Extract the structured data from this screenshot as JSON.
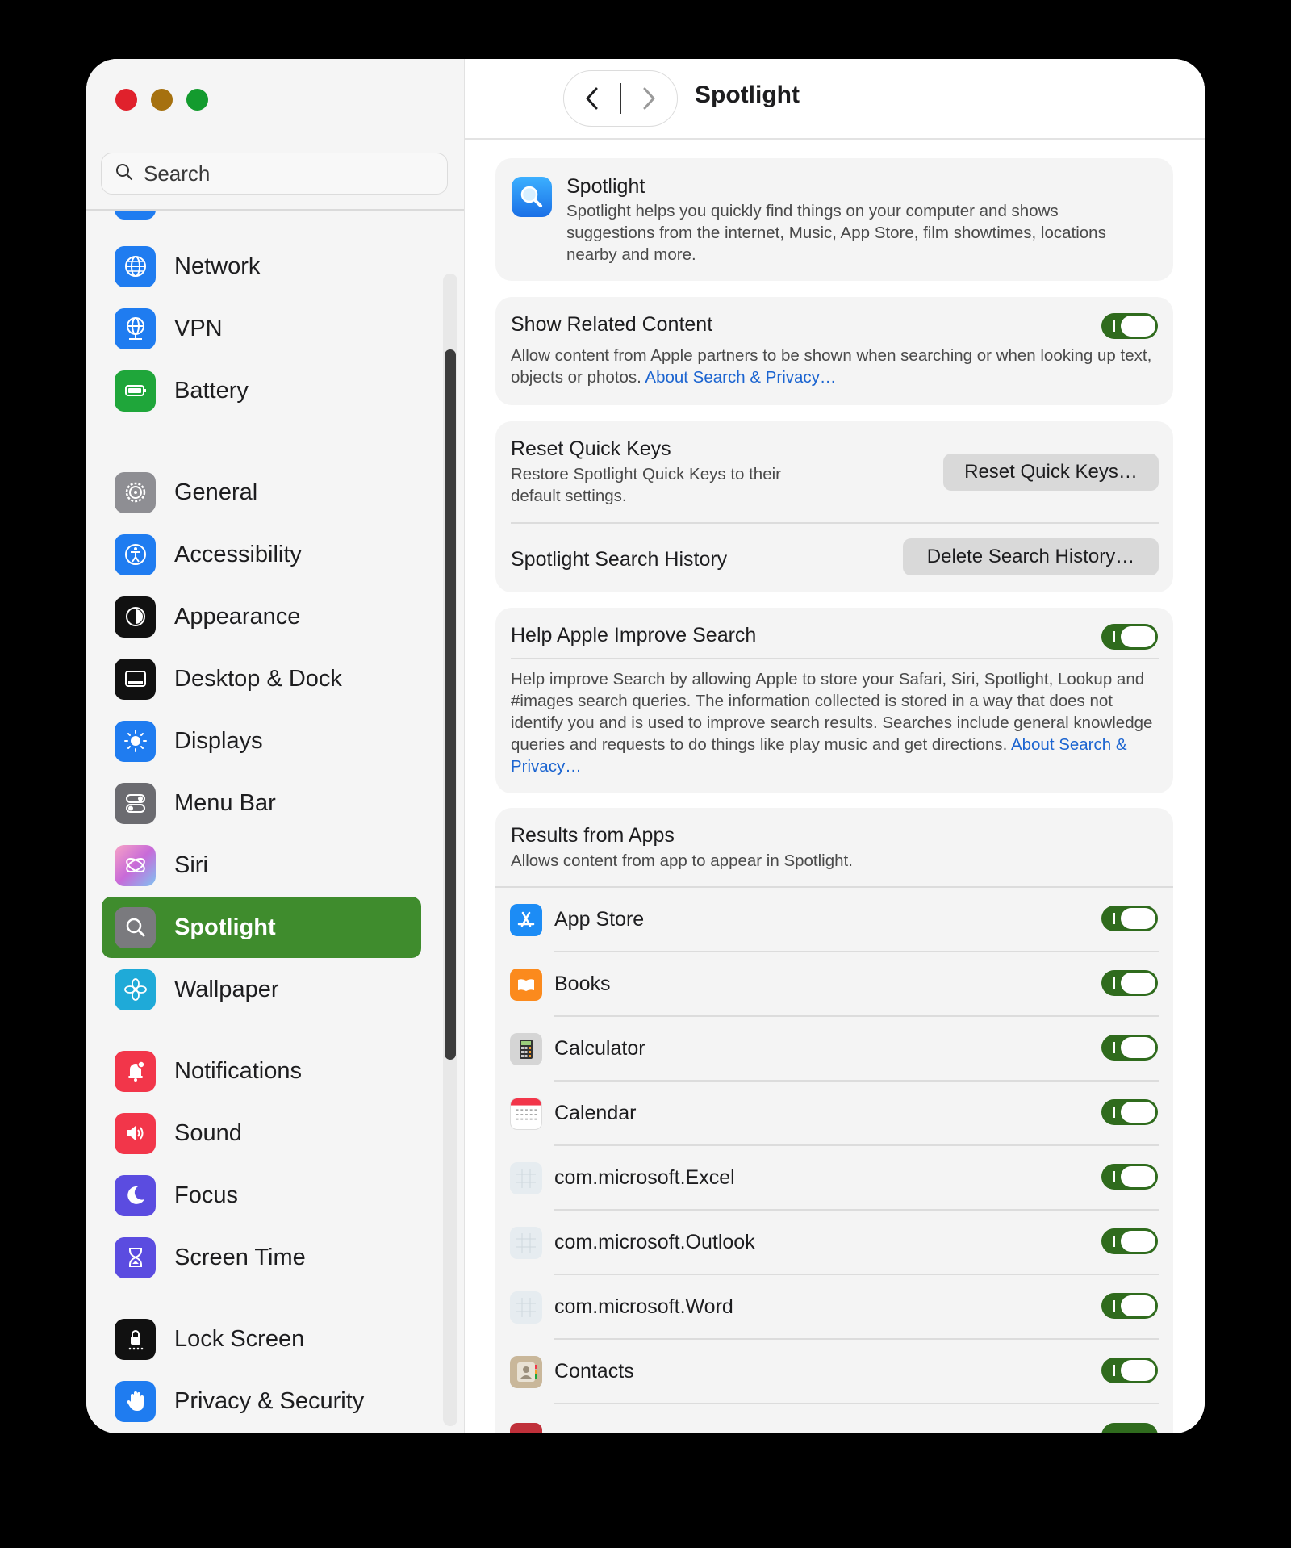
{
  "window": {
    "title": "Spotlight"
  },
  "sidebar": {
    "search_placeholder": "Search",
    "items": [
      {
        "label": "Network",
        "icon": "globe-icon",
        "color": "#1f7cf0"
      },
      {
        "label": "VPN",
        "icon": "vpn-globe-icon",
        "color": "#1f7cf0"
      },
      {
        "label": "Battery",
        "icon": "battery-icon",
        "color": "#1fa63a"
      },
      {
        "label": "General",
        "icon": "gear-icon",
        "color": "#8e8e93"
      },
      {
        "label": "Accessibility",
        "icon": "accessibility-icon",
        "color": "#1f7cf0"
      },
      {
        "label": "Appearance",
        "icon": "appearance-icon",
        "color": "#111111"
      },
      {
        "label": "Desktop & Dock",
        "icon": "dock-icon",
        "color": "#111111"
      },
      {
        "label": "Displays",
        "icon": "sun-icon",
        "color": "#1f7cf0"
      },
      {
        "label": "Menu Bar",
        "icon": "toggles-icon",
        "color": "#6b6b70"
      },
      {
        "label": "Siri",
        "icon": "siri-icon",
        "color": "#c86ad8"
      },
      {
        "label": "Spotlight",
        "icon": "magnifier-icon",
        "color": "#7a7a7e"
      },
      {
        "label": "Wallpaper",
        "icon": "flower-icon",
        "color": "#1faad8"
      },
      {
        "label": "Notifications",
        "icon": "bell-icon",
        "color": "#f2364a"
      },
      {
        "label": "Sound",
        "icon": "speaker-icon",
        "color": "#f2364a"
      },
      {
        "label": "Focus",
        "icon": "moon-icon",
        "color": "#5b4ce0"
      },
      {
        "label": "Screen Time",
        "icon": "hourglass-icon",
        "color": "#5b4ce0"
      },
      {
        "label": "Lock Screen",
        "icon": "lock-icon",
        "color": "#111111"
      },
      {
        "label": "Privacy & Security",
        "icon": "hand-icon",
        "color": "#1f7cf0"
      }
    ],
    "selected": "Spotlight",
    "selected_color": "#3f8c2d"
  },
  "header": {
    "title": "Spotlight"
  },
  "main": {
    "intro": {
      "title": "Spotlight",
      "description": "Spotlight helps you quickly find things on your computer and shows suggestions from the internet, Music, App Store, film showtimes, locations nearby and more."
    },
    "related": {
      "title": "Show Related Content",
      "description": "Allow content from Apple partners to be shown when searching or when looking up text, objects or photos.",
      "link": "About Search & Privacy…",
      "enabled": true
    },
    "quick_keys": {
      "title": "Reset Quick Keys",
      "description": "Restore Spotlight Quick Keys to their default settings.",
      "button": "Reset Quick Keys…"
    },
    "history": {
      "title": "Spotlight Search History",
      "button": "Delete Search History…"
    },
    "improve": {
      "title": "Help Apple Improve Search",
      "description": "Help improve Search by allowing Apple to store your Safari, Siri, Spotlight, Lookup and #images search queries. The information collected is stored in a way that does not identify you and is used to improve search results. Searches include general knowledge queries and requests to do things like play music and get directions.",
      "link": "About Search & Privacy…",
      "enabled": true
    },
    "results": {
      "title": "Results from Apps",
      "description": "Allows content from app to appear in Spotlight.",
      "apps": [
        {
          "label": "App Store",
          "icon": "app-store-icon",
          "enabled": true
        },
        {
          "label": "Books",
          "icon": "books-icon",
          "enabled": true
        },
        {
          "label": "Calculator",
          "icon": "calculator-icon",
          "enabled": true
        },
        {
          "label": "Calendar",
          "icon": "calendar-icon",
          "enabled": true
        },
        {
          "label": "com.microsoft.Excel",
          "icon": "generic-app-icon",
          "enabled": true
        },
        {
          "label": "com.microsoft.Outlook",
          "icon": "generic-app-icon",
          "enabled": true
        },
        {
          "label": "com.microsoft.Word",
          "icon": "generic-app-icon",
          "enabled": true
        },
        {
          "label": "Contacts",
          "icon": "contacts-icon",
          "enabled": true
        }
      ]
    },
    "toggle_color": "#2f6b1d",
    "link_color": "#1b64d0"
  }
}
